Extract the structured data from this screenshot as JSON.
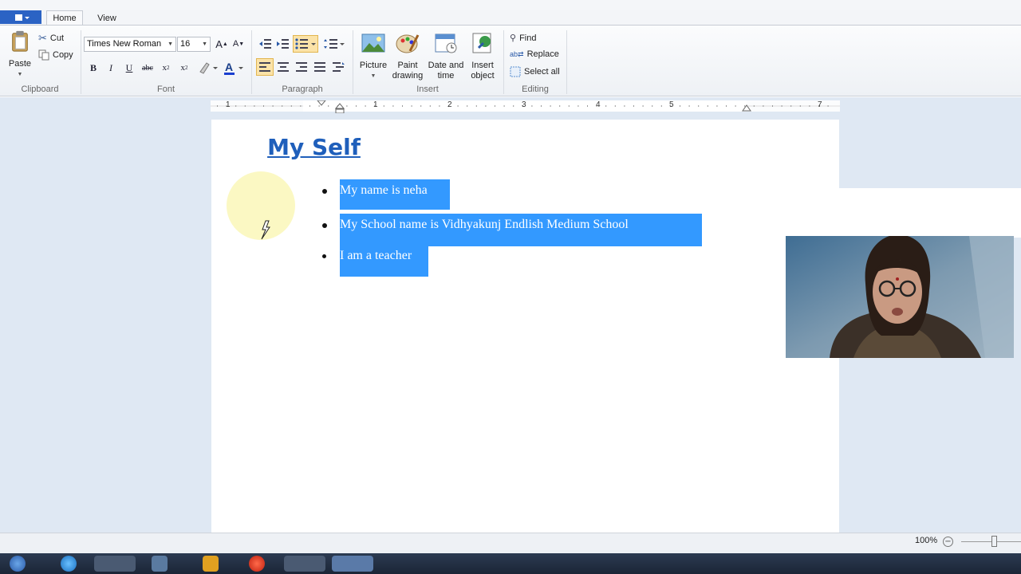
{
  "tabs": {
    "home": "Home",
    "view": "View"
  },
  "clipboard": {
    "paste": "Paste",
    "cut": "Cut",
    "copy": "Copy",
    "label": "Clipboard"
  },
  "font": {
    "family": "Times New Roman",
    "size": "16",
    "label": "Font"
  },
  "paragraph": {
    "label": "Paragraph"
  },
  "insert": {
    "picture": "Picture",
    "paint_drawing": "Paint drawing",
    "date_time": "Date and time",
    "insert_object": "Insert object",
    "label": "Insert"
  },
  "editing": {
    "find": "Find",
    "replace": "Replace",
    "select_all": "Select all",
    "label": "Editing"
  },
  "ruler": {
    "numbers": [
      "1",
      "1",
      "2",
      "3",
      "4",
      "5",
      "7"
    ]
  },
  "document": {
    "title": "My Self",
    "items": [
      "My name is neha",
      "My School name is Vidhyakunj Endlish Medium School",
      "I am a teacher"
    ]
  },
  "status": {
    "zoom": "100%"
  },
  "colors": {
    "selection": "#3399ff",
    "title": "#1f5fbb",
    "workspace": "#dfe8f3"
  }
}
